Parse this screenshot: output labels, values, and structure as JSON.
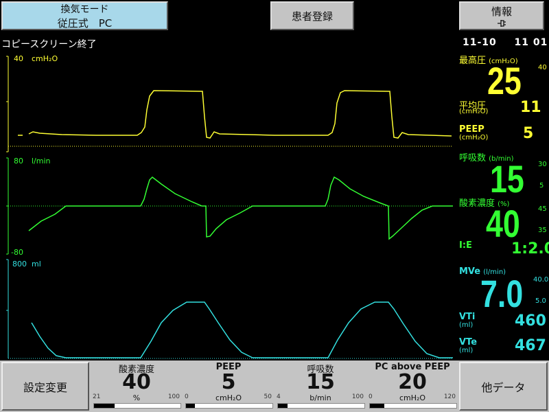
{
  "top": {
    "mode_label": "換気モード",
    "mode_value": "従圧式　PC",
    "patient_button": "患者登録",
    "info_button": "情報",
    "info_icon": "plug-icon"
  },
  "banner": "コピースクリーン終了",
  "clock": {
    "date": "11-10",
    "time": "11 01"
  },
  "waveforms": {
    "pressure": {
      "max_label": "40",
      "unit": "cmH₂O"
    },
    "flow": {
      "max_label": "80",
      "min_label": "-80",
      "unit": "l/min"
    },
    "volume": {
      "max_label": "800",
      "unit": "ml"
    }
  },
  "readouts": {
    "pmax": {
      "label": "最高圧",
      "unit": "(cmH₂O)",
      "value": "25",
      "alarm_high": "40"
    },
    "pmean": {
      "label": "平均圧",
      "unit": "(cmH₂O)",
      "value": "11"
    },
    "peep": {
      "label": "PEEP",
      "unit": "(cmH₂O)",
      "value": "5"
    },
    "rr": {
      "label": "呼吸数",
      "unit": "(b/min)",
      "value": "15",
      "alarm_high": "30",
      "alarm_low": "5"
    },
    "o2": {
      "label": "酸素濃度",
      "unit": "(%)",
      "value": "40",
      "alarm_high": "45",
      "alarm_low": "35"
    },
    "ie": {
      "label": "I:E",
      "value": "1:2.0"
    },
    "mve": {
      "label": "MVe",
      "unit": "(l/min)",
      "value": "7.0",
      "alarm_high": "40.0",
      "alarm_low": "5.0"
    },
    "vti": {
      "label": "VTi",
      "unit": "(ml)",
      "value": "460"
    },
    "vte": {
      "label": "VTe",
      "unit": "(ml)",
      "value": "467"
    }
  },
  "bottom": {
    "settings_button": "設定変更",
    "other_button": "他データ",
    "knobs": [
      {
        "title": "酸素濃度",
        "value": "40",
        "unit": "%",
        "min": "21",
        "max": "100",
        "level_pct": 24
      },
      {
        "title": "PEEP",
        "value": "5",
        "unit": "cmH₂O",
        "min": "0",
        "max": "50",
        "level_pct": 10
      },
      {
        "title": "呼吸数",
        "value": "15",
        "unit": "b/min",
        "min": "4",
        "max": "100",
        "level_pct": 11
      },
      {
        "title": "PC above PEEP",
        "value": "20",
        "unit": "cmH₂O",
        "min": "0",
        "max": "120",
        "level_pct": 17
      }
    ]
  },
  "colors": {
    "pressure": "#ffff33",
    "flow": "#33ff33",
    "volume": "#33e0e0",
    "active_button": "#a8d8ea"
  }
}
